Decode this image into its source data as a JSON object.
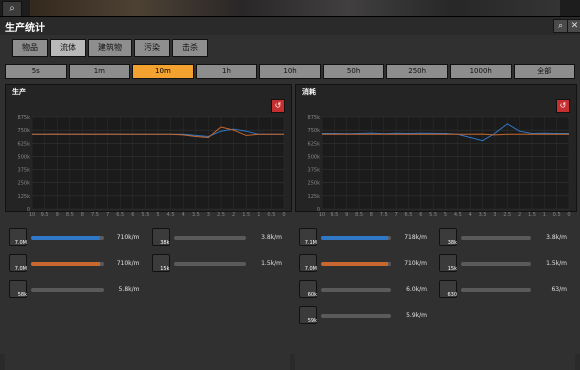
{
  "window": {
    "title": "生产统计"
  },
  "tabs": [
    "物品",
    "流体",
    "建筑物",
    "污染",
    "击杀"
  ],
  "time_ranges": [
    "5s",
    "1m",
    "10m",
    "1h",
    "10h",
    "50h",
    "250h",
    "1000h",
    "全部"
  ],
  "active_time": "10m",
  "panels": {
    "left": {
      "title": "生产",
      "chart_data": {
        "type": "line",
        "y_ticks": [
          "875k",
          "750k",
          "625k",
          "500k",
          "375k",
          "250k",
          "125k",
          "0"
        ],
        "x_ticks": [
          "10",
          "9.5",
          "9",
          "8.5",
          "8",
          "7.5",
          "7",
          "6.5",
          "6",
          "5.5",
          "5",
          "4.5",
          "4",
          "3.5",
          "3",
          "2.5",
          "2",
          "1.5",
          "1",
          "0.5",
          "0"
        ],
        "series": [
          {
            "color": "#2f78c7",
            "values": [
              710,
              710,
              710,
              710,
              710,
              710,
              710,
              710,
              710,
              710,
              710,
              710,
              710,
              700,
              690,
              740,
              760,
              740,
              710,
              710,
              710
            ]
          },
          {
            "color": "#c8672e",
            "values": [
              710,
              710,
              712,
              710,
              712,
              710,
              712,
              710,
              710,
              710,
              710,
              710,
              705,
              690,
              680,
              780,
              750,
              700,
              710,
              710,
              710
            ]
          }
        ]
      }
    },
    "right": {
      "title": "消耗",
      "chart_data": {
        "type": "line",
        "y_ticks": [
          "875k",
          "750k",
          "625k",
          "500k",
          "375k",
          "250k",
          "125k",
          "0"
        ],
        "x_ticks": [
          "10",
          "9.5",
          "9",
          "8.5",
          "8",
          "7.5",
          "7",
          "6.5",
          "6",
          "5.5",
          "5",
          "4.5",
          "4",
          "3.5",
          "3",
          "2.5",
          "2",
          "1.5",
          "1",
          "0.5",
          "0"
        ],
        "series": [
          {
            "color": "#2f78c7",
            "values": [
              718,
              718,
              715,
              718,
              722,
              716,
              720,
              718,
              720,
              719,
              718,
              710,
              680,
              650,
              720,
              810,
              740,
              718,
              720,
              718,
              718
            ]
          },
          {
            "color": "#c8672e",
            "values": [
              710,
              710,
              710,
              710,
              710,
              710,
              710,
              710,
              710,
              710,
              710,
              710,
              710,
              712,
              705,
              710,
              710,
              710,
              710,
              710,
              710
            ]
          }
        ]
      }
    }
  },
  "left_rows": [
    {
      "label": "7.0M",
      "val": "710k/m",
      "fill": 0.95,
      "color": "#2f78c7",
      "col": 0
    },
    {
      "label": "7.0M",
      "val": "710k/m",
      "fill": 0.95,
      "color": "#c8672e",
      "col": 0
    },
    {
      "label": "58k",
      "val": "5.8k/m",
      "fill": 0.0,
      "color": "#777",
      "col": 0
    },
    {
      "label": "38k",
      "val": "3.8k/m",
      "fill": 0.0,
      "color": "#777",
      "col": 1
    },
    {
      "label": "15k",
      "val": "1.5k/m",
      "fill": 0.0,
      "color": "#777",
      "col": 1
    }
  ],
  "right_rows": [
    {
      "label": "7.1M",
      "val": "718k/m",
      "fill": 0.95,
      "color": "#2f78c7",
      "col": 0
    },
    {
      "label": "7.0M",
      "val": "710k/m",
      "fill": 0.95,
      "color": "#c8672e",
      "col": 0
    },
    {
      "label": "60k",
      "val": "6.0k/m",
      "fill": 0.0,
      "color": "#777",
      "col": 0
    },
    {
      "label": "59k",
      "val": "5.9k/m",
      "fill": 0.0,
      "color": "#777",
      "col": 0
    },
    {
      "label": "38k",
      "val": "3.8k/m",
      "fill": 0.0,
      "color": "#777",
      "col": 1
    },
    {
      "label": "15k",
      "val": "1.5k/m",
      "fill": 0.0,
      "color": "#777",
      "col": 1
    },
    {
      "label": "630",
      "val": "63/m",
      "fill": 0.0,
      "color": "#777",
      "col": 1
    }
  ]
}
